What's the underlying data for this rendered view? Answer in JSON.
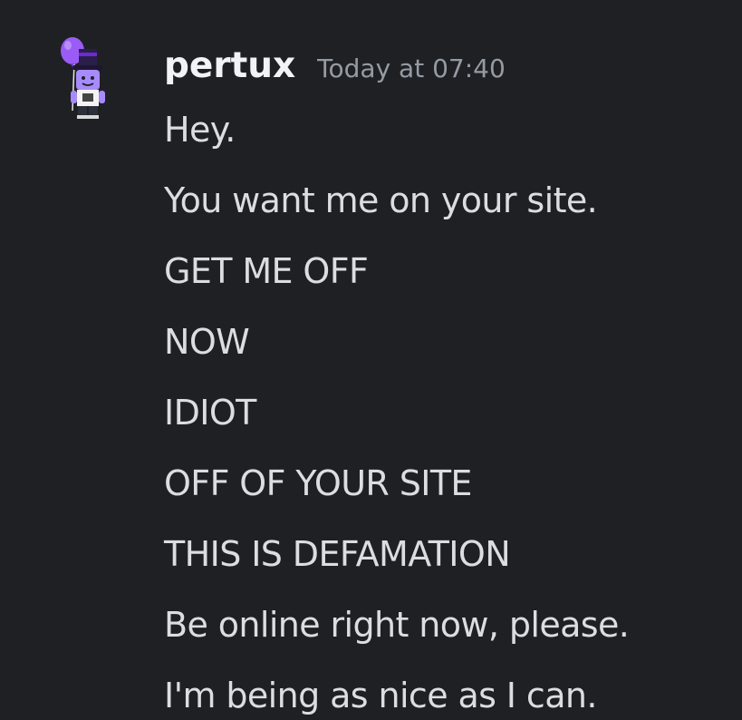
{
  "message": {
    "author": "pertux",
    "timestamp": "Today at 07:40",
    "avatar_icon": "purple-balloon-character-avatar",
    "lines": [
      "Hey.",
      "You want me on your site.",
      "GET ME OFF",
      "NOW",
      "IDIOT",
      "OFF OF YOUR SITE",
      "THIS IS DEFAMATION",
      "Be online right now, please.",
      "I'm being as nice as I can."
    ]
  },
  "colors": {
    "background": "#1f2024",
    "username": "#f2f3f5",
    "timestamp": "#949ba4",
    "text": "#dbdee1"
  }
}
